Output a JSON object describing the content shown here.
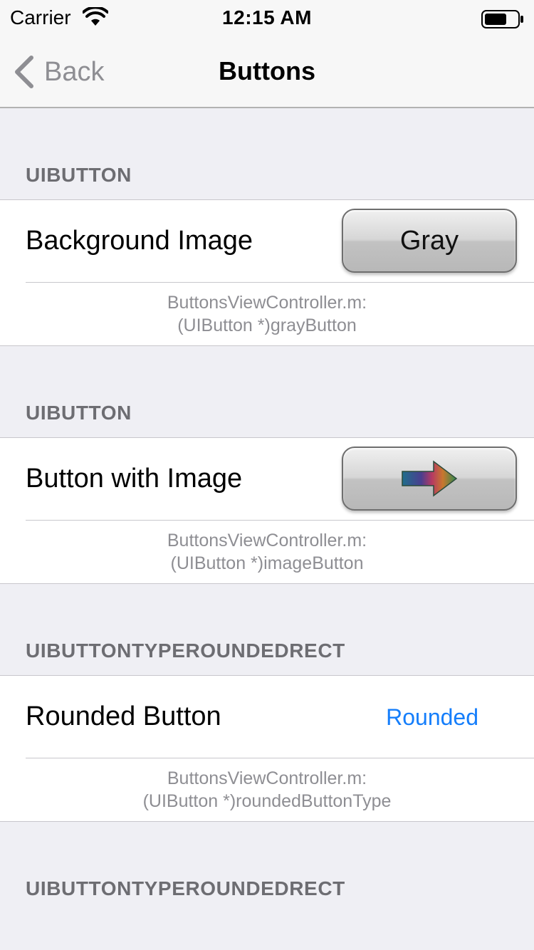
{
  "status_bar": {
    "carrier": "Carrier",
    "time": "12:15 AM"
  },
  "nav": {
    "back_label": "Back",
    "title": "Buttons"
  },
  "sections": [
    {
      "header": "UIBUTTON",
      "title": "Background Image",
      "control_label": "Gray",
      "subtitle_line1": "ButtonsViewController.m:",
      "subtitle_line2": "(UIButton *)grayButton"
    },
    {
      "header": "UIBUTTON",
      "title": "Button with Image",
      "control_icon": "arrow-right-icon",
      "subtitle_line1": "ButtonsViewController.m:",
      "subtitle_line2": "(UIButton *)imageButton"
    },
    {
      "header": "UIBUTTONTYPEROUNDEDRECT",
      "title": "Rounded Button",
      "control_label": "Rounded",
      "subtitle_line1": "ButtonsViewController.m:",
      "subtitle_line2": "(UIButton *)roundedButtonType"
    },
    {
      "header": "UIBUTTONTYPEROUNDEDRECT"
    }
  ],
  "colors": {
    "tint": "#157efb",
    "background": "#efeff4",
    "header_text": "#6d6d72",
    "subtitle_text": "#8e8e93"
  }
}
